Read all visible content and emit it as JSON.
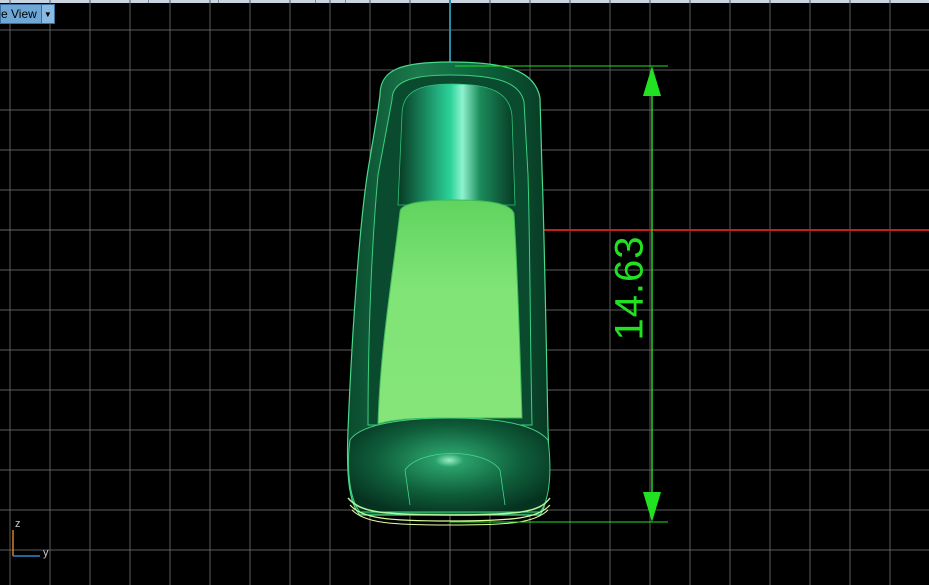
{
  "viewport": {
    "view_selector_label": "e View",
    "dimension_value": "14.63",
    "axis_labels": {
      "z": "z",
      "y": "y"
    }
  },
  "colors": {
    "background": "#000000",
    "grid": "#5a5a5a",
    "x_axis": "#c02020",
    "vertical_axis": "#2a8aa0",
    "dimension": "#22e022",
    "shoe_dark": "#0d5a38",
    "shoe_mid": "#1a8a55",
    "insole": "#7ee070"
  },
  "icons": {
    "dropdown": "chevron-down-icon",
    "axis_gizmo": "axis-gizmo-icon"
  }
}
